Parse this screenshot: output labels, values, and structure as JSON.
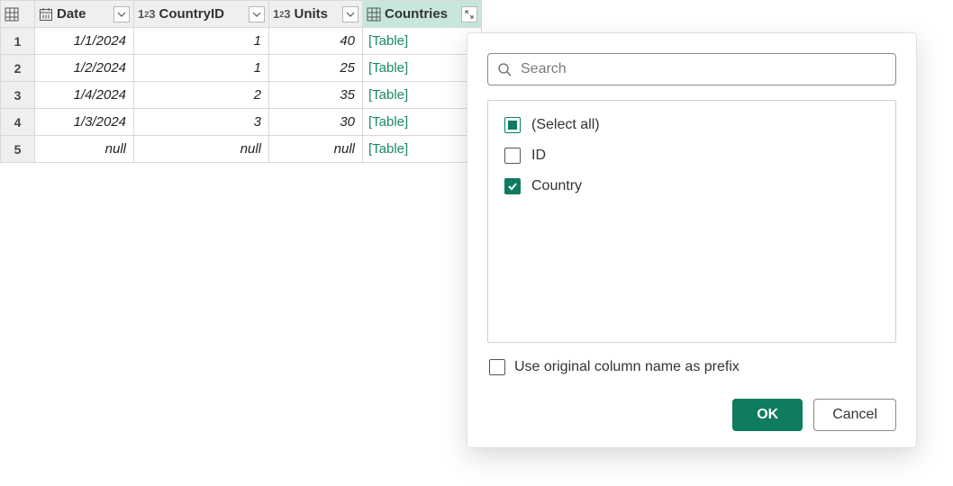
{
  "columns": {
    "date": {
      "label": "Date",
      "type": "date"
    },
    "cid": {
      "label": "CountryID",
      "type": "number"
    },
    "units": {
      "label": "Units",
      "type": "number"
    },
    "ctry": {
      "label": "Countries",
      "type": "table"
    }
  },
  "rows": [
    {
      "n": "1",
      "date": "1/1/2024",
      "cid": "1",
      "units": "40",
      "ctry": "[Table]"
    },
    {
      "n": "2",
      "date": "1/2/2024",
      "cid": "1",
      "units": "25",
      "ctry": "[Table]"
    },
    {
      "n": "3",
      "date": "1/4/2024",
      "cid": "2",
      "units": "35",
      "ctry": "[Table]"
    },
    {
      "n": "4",
      "date": "1/3/2024",
      "cid": "3",
      "units": "30",
      "ctry": "[Table]"
    },
    {
      "n": "5",
      "date": "null",
      "cid": "null",
      "units": "null",
      "ctry": "[Table]"
    }
  ],
  "popup": {
    "search_placeholder": "Search",
    "select_all_label": "(Select all)",
    "items": [
      {
        "label": "ID",
        "checked": false
      },
      {
        "label": "Country",
        "checked": true
      }
    ],
    "prefix_label": "Use original column name as prefix",
    "ok_label": "OK",
    "cancel_label": "Cancel"
  },
  "colors": {
    "accent": "#0f7b5f",
    "link": "#1b8968",
    "header_bg": "#eeefef",
    "header_selected": "#c7e6de"
  }
}
